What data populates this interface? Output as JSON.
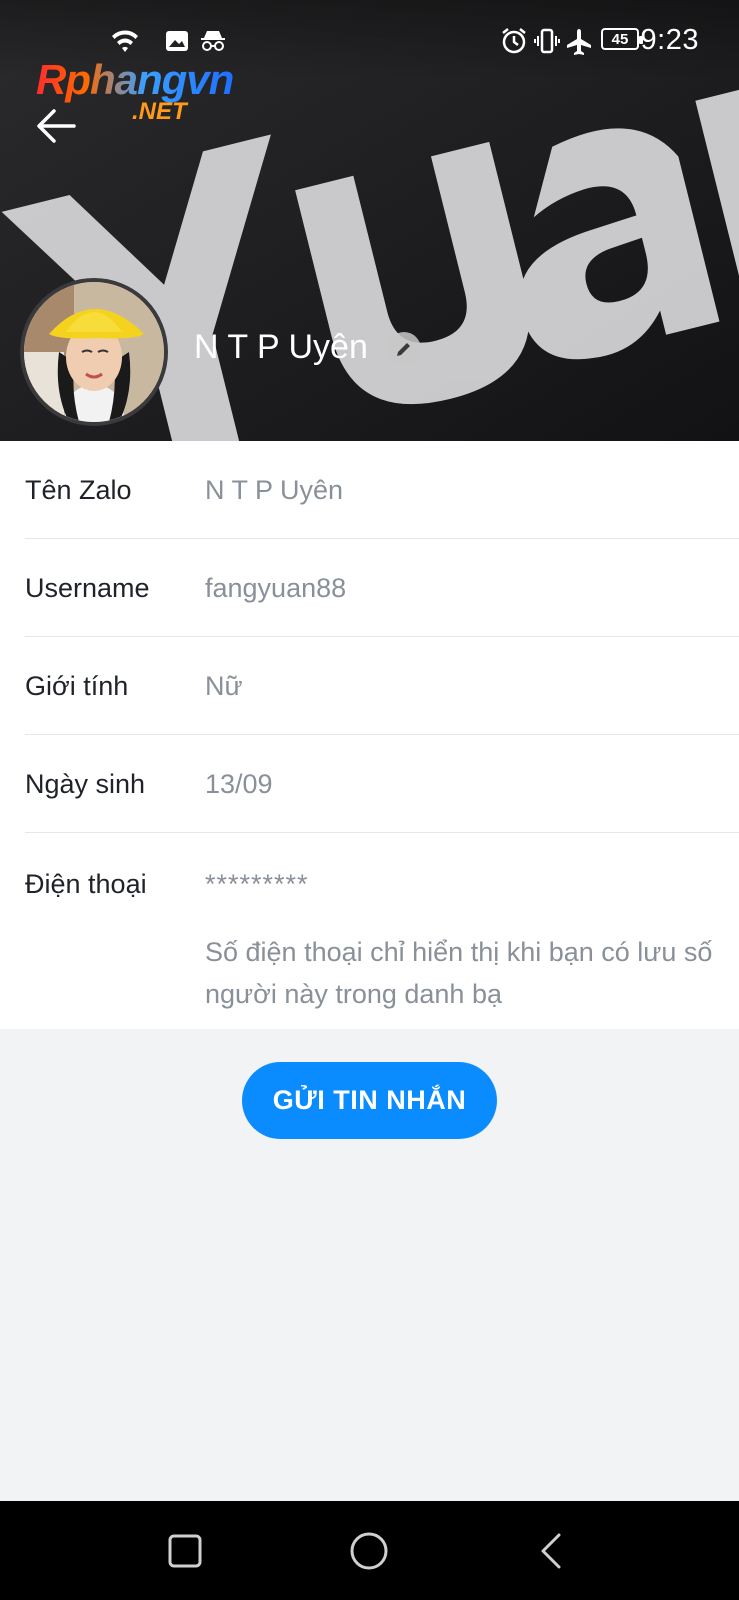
{
  "status_bar": {
    "time": "9:23",
    "battery": "45",
    "left_icons": [
      "wifi-icon",
      "image-icon",
      "incognito-icon"
    ],
    "right_icons": [
      "alarm-icon",
      "vibrate-icon",
      "airplane-icon",
      "battery-icon"
    ]
  },
  "watermark": {
    "main": "Rphangvn",
    "sub": ".NET"
  },
  "cover": {
    "art_text": "Yuan"
  },
  "profile": {
    "name": "N T P Uyên"
  },
  "info": {
    "rows": [
      {
        "label": "Tên Zalo",
        "value": "N T P Uyên"
      },
      {
        "label": "Username",
        "value": "fangyuan88"
      },
      {
        "label": "Giới tính",
        "value": "Nữ"
      },
      {
        "label": "Ngày sinh",
        "value": "13/09"
      }
    ],
    "phone": {
      "label": "Điện thoại",
      "value": "*********",
      "note": "Số điện thoại chỉ hiển thị khi bạn có lưu số người này trong danh bạ"
    }
  },
  "actions": {
    "send_message": "GỬI TIN NHẮN"
  },
  "nav": {
    "icons": [
      "recent-apps-icon",
      "home-icon",
      "back-icon"
    ]
  },
  "colors": {
    "accent": "#0a8cff",
    "label": "#1f2329",
    "value": "#8a9099",
    "background": "#f1f3f5"
  }
}
